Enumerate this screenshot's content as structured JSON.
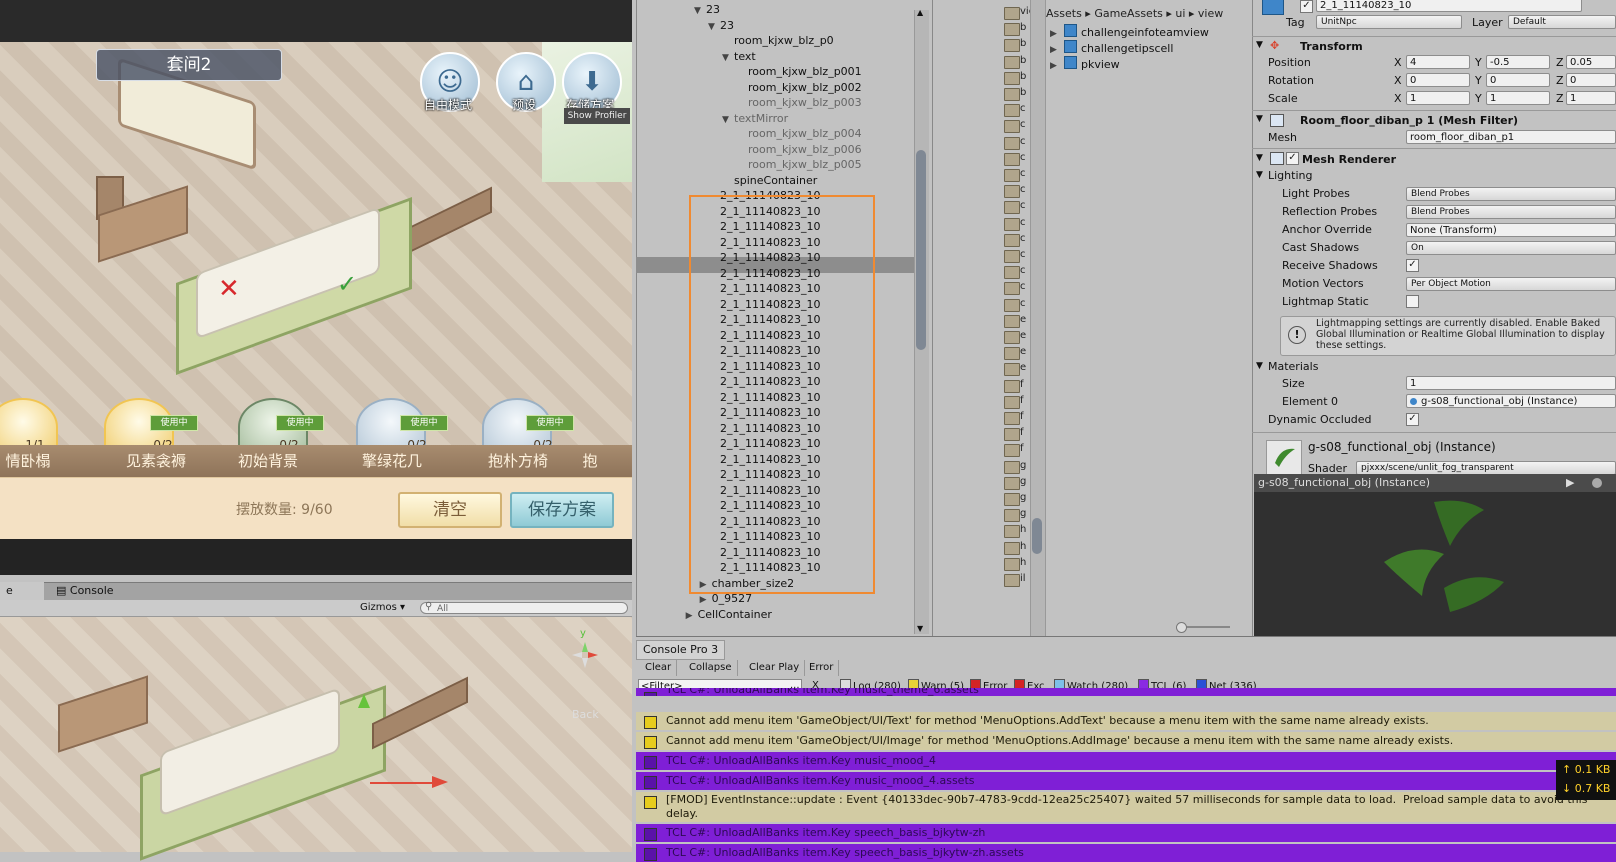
{
  "game": {
    "room_title": "套间2",
    "top_buttons": [
      "自由模式",
      "预设",
      "存储方案"
    ],
    "profiler_tip": "Show Profiler",
    "categories": [
      "情卧榻",
      "见素衾褥",
      "初始背景",
      "擎绿花几",
      "抱朴方椅",
      "抱"
    ],
    "slots": [
      {
        "count": "1/1",
        "in_use": ""
      },
      {
        "count": "0/2",
        "in_use": "使用中"
      },
      {
        "count": "0/2",
        "in_use": "使用中"
      },
      {
        "count": "0/2",
        "in_use": "使用中"
      },
      {
        "count": "0/2",
        "in_use": "使用中"
      }
    ],
    "placement_label": "摆放数量:  9/60",
    "clear_button": "清空",
    "save_button": "保存方案"
  },
  "scene": {
    "tabs": [
      "e",
      "Console"
    ],
    "gizmos": "Gizmos ▾",
    "search_placeholder": "All",
    "gizmo_axis": "y",
    "back_label": "Back"
  },
  "hierarchy": {
    "rows": [
      {
        "indent": 0,
        "arrow": "▼",
        "label": "23",
        "dim": false
      },
      {
        "indent": 1,
        "arrow": "▼",
        "label": "23",
        "dim": false
      },
      {
        "indent": 2,
        "arrow": "",
        "label": "room_kjxw_blz_p0",
        "dim": false
      },
      {
        "indent": 2,
        "arrow": "▼",
        "label": "text",
        "dim": false
      },
      {
        "indent": 3,
        "arrow": "",
        "label": "room_kjxw_blz_p001",
        "dim": false
      },
      {
        "indent": 3,
        "arrow": "",
        "label": "room_kjxw_blz_p002",
        "dim": false
      },
      {
        "indent": 3,
        "arrow": "",
        "label": "room_kjxw_blz_p003",
        "dim": true
      },
      {
        "indent": 2,
        "arrow": "▼",
        "label": "textMirror",
        "dim": true
      },
      {
        "indent": 3,
        "arrow": "",
        "label": "room_kjxw_blz_p004",
        "dim": true
      },
      {
        "indent": 3,
        "arrow": "",
        "label": "room_kjxw_blz_p006",
        "dim": true
      },
      {
        "indent": 3,
        "arrow": "",
        "label": "room_kjxw_blz_p005",
        "dim": true
      },
      {
        "indent": 2,
        "arrow": "",
        "label": "spineContainer",
        "dim": false
      }
    ],
    "repeated_label": "2_1_11140823_10",
    "repeated_count": 25,
    "selected_index": 4,
    "tail_rows": [
      {
        "indent": 1,
        "arrow": "▶",
        "label": "chamber_size2"
      },
      {
        "indent": 1,
        "arrow": "▶",
        "label": "0_9527"
      },
      {
        "indent": 0,
        "arrow": "▶",
        "label": "CellContainer"
      }
    ]
  },
  "project": {
    "breadcrumb": "Assets ▸ GameAssets ▸ ui ▸ view",
    "items": [
      "challengeinfoteamview",
      "challengetipscell",
      "pkview"
    ],
    "folder_letters": [
      "vie",
      "b",
      "b",
      "b",
      "b",
      "b",
      "c",
      "c",
      "c",
      "c",
      "c",
      "c",
      "c",
      "c",
      "c",
      "c",
      "c",
      "c",
      "c",
      "e",
      "e",
      "e",
      "e",
      "f",
      "f",
      "f",
      "f",
      "f",
      "g",
      "g",
      "g",
      "g",
      "h",
      "h",
      "h",
      "il"
    ]
  },
  "inspector": {
    "object_name": "2_1_11140823_10",
    "tag_label": "Tag",
    "tag_value": "UnitNpc",
    "layer_label": "Layer",
    "layer_value": "Default",
    "transform": {
      "header": "Transform",
      "position_label": "Position",
      "rotation_label": "Rotation",
      "scale_label": "Scale",
      "position": [
        "4",
        "-0.5",
        "0.05"
      ],
      "rotation": [
        "0",
        "0",
        "0"
      ],
      "scale": [
        "1",
        "1",
        "1"
      ]
    },
    "mesh_filter": {
      "header": "Room_floor_diban_p 1 (Mesh Filter)",
      "mesh_label": "Mesh",
      "mesh_value": "room_floor_diban_p1"
    },
    "mesh_renderer": {
      "header": "Mesh Renderer",
      "lighting": "Lighting",
      "light_probes_label": "Light Probes",
      "light_probes": "Blend Probes",
      "reflection_probes_label": "Reflection Probes",
      "reflection_probes": "Blend Probes",
      "anchor_override_label": "Anchor Override",
      "anchor_override": "None (Transform)",
      "cast_shadows_label": "Cast Shadows",
      "cast_shadows": "On",
      "receive_shadows_label": "Receive Shadows",
      "motion_vectors_label": "Motion Vectors",
      "motion_vectors": "Per Object Motion",
      "lightmap_static_label": "Lightmap Static",
      "info": "Lightmapping settings are currently disabled. Enable Baked Global Illumination or Realtime Global Illumination to display these settings.",
      "materials": "Materials",
      "size_label": "Size",
      "size": "1",
      "element0_label": "Element 0",
      "element0": "g-s08_functional_obj (Instance)",
      "dynamic_occluded_label": "Dynamic Occluded"
    },
    "material": {
      "name": "g-s08_functional_obj (Instance)",
      "shader_label": "Shader",
      "shader": "pjxxx/scene/unlit_fog_transparent"
    },
    "preview_title": "g-s08_functional_obj (Instance)"
  },
  "console": {
    "tab": "Console Pro 3",
    "buttons": [
      "Clear",
      "Collapse",
      "Clear Play",
      "Error"
    ],
    "filter": "<Filter>",
    "filter_more": "...",
    "filter_clear": "X",
    "tags": [
      {
        "label": "Log (280)",
        "color": "#dcdcdc"
      },
      {
        "label": "Warn (5)",
        "color": "#e8d238"
      },
      {
        "label": "Error",
        "color": "#d42424"
      },
      {
        "label": "Exc",
        "color": "#d42424"
      },
      {
        "label": "Watch (280)",
        "color": "#7ec0e8"
      },
      {
        "label": "TCL (6)",
        "color": "#8a2be2"
      },
      {
        "label": "Net (336)",
        "color": "#2a4fd6"
      }
    ],
    "rows": [
      {
        "type": "purple",
        "text": "TCL C#: UnloadAllBanks item.Key music_theme_6.assets"
      },
      {
        "type": "tan",
        "text": "Cannot add menu item 'GameObject/UI/Text' for method 'MenuOptions.AddText' because a menu item with the same name already exists."
      },
      {
        "type": "tan",
        "text": "Cannot add menu item 'GameObject/UI/Image' for method 'MenuOptions.AddImage' because a menu item with the same name already exists."
      },
      {
        "type": "purple",
        "text": "TCL C#: UnloadAllBanks item.Key music_mood_4"
      },
      {
        "type": "purple",
        "text": "TCL C#: UnloadAllBanks item.Key music_mood_4.assets"
      },
      {
        "type": "tan",
        "text": "[FMOD] EventInstance::update : Event {40133dec-90b7-4783-9cdd-12ea25c25407} waited 57 milliseconds for sample data to load.  Preload sample data to avoid this\ndelay."
      },
      {
        "type": "purple",
        "text": "TCL C#: UnloadAllBanks item.Key speech_basis_bjkytw-zh"
      },
      {
        "type": "purple",
        "text": "TCL C#: UnloadAllBanks item.Key speech_basis_bjkytw-zh.assets"
      }
    ],
    "net_up": "↑ 0.1 KB",
    "net_down": "↓ 0.7 KB"
  }
}
